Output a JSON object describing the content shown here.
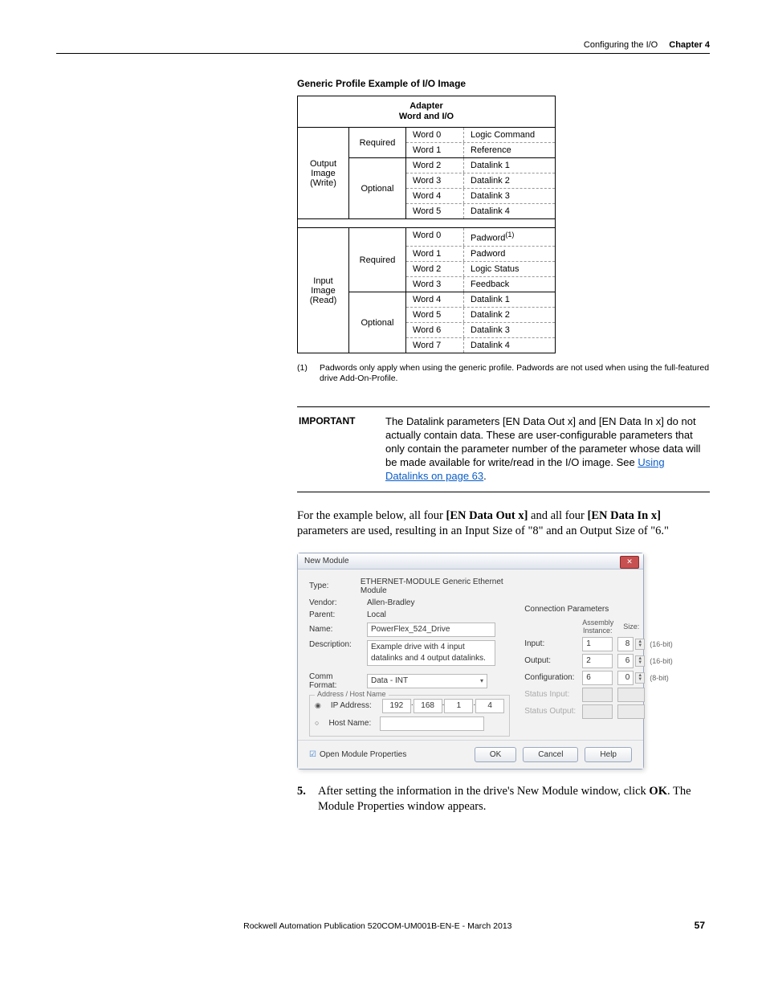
{
  "header": {
    "breadcrumb": "Configuring the I/O",
    "chapter": "Chapter 4"
  },
  "section_title": "Generic Profile Example of I/O Image",
  "adapter": {
    "title1": "Adapter",
    "title2": "Word and I/O",
    "groups": [
      {
        "label": "Output Image (Write)",
        "sub": [
          {
            "type": "Required",
            "rows": [
              {
                "word": "Word 0",
                "val": "Logic Command"
              },
              {
                "word": "Word 1",
                "val": "Reference"
              }
            ]
          },
          {
            "type": "Optional",
            "rows": [
              {
                "word": "Word 2",
                "val": "Datalink 1"
              },
              {
                "word": "Word 3",
                "val": "Datalink 2"
              },
              {
                "word": "Word 4",
                "val": "Datalink 3"
              },
              {
                "word": "Word 5",
                "val": "Datalink 4"
              }
            ]
          }
        ]
      },
      {
        "label": "Input Image (Read)",
        "sub": [
          {
            "type": "Required",
            "rows": [
              {
                "word": "Word 0",
                "val_raw": "Padword",
                "sup": "(1)"
              },
              {
                "word": "Word 1",
                "val": "Padword"
              },
              {
                "word": "Word 2",
                "val": "Logic Status"
              },
              {
                "word": "Word 3",
                "val": "Feedback"
              }
            ]
          },
          {
            "type": "Optional",
            "rows": [
              {
                "word": "Word 4",
                "val": "Datalink 1"
              },
              {
                "word": "Word 5",
                "val": "Datalink 2"
              },
              {
                "word": "Word 6",
                "val": "Datalink 3"
              },
              {
                "word": "Word 7",
                "val": "Datalink 4"
              }
            ]
          }
        ]
      }
    ]
  },
  "footnote": {
    "num": "(1)",
    "text": "Padwords only apply when using the generic profile. Padwords are not used when using the full-featured drive Add-On-Profile."
  },
  "important": {
    "label": "IMPORTANT",
    "text_pre": "The Datalink parameters [EN Data Out x] and [EN Data In x] do not actually contain data. These are user-configurable parameters that only contain the parameter number of the parameter whose data will be made available for write/read in the I/O image. See ",
    "link": "Using Datalinks on page 63",
    "text_post": "."
  },
  "body_para": "For the example below, all four [EN Data Out x] and all four [EN Data In x] parameters are used, resulting in an Input Size of \"8\" and an Output Size of \"6.\"",
  "dialog": {
    "title": "New Module",
    "type_lbl": "Type:",
    "type_val": "ETHERNET-MODULE Generic Ethernet Module",
    "vendor_lbl": "Vendor:",
    "vendor_val": "Allen-Bradley",
    "parent_lbl": "Parent:",
    "parent_val": "Local",
    "name_lbl": "Name:",
    "name_val": "PowerFlex_524_Drive",
    "desc_lbl": "Description:",
    "desc_val": "Example drive with 4 input datalinks and 4 output datalinks.",
    "comm_lbl": "Comm Format:",
    "comm_val": "Data - INT",
    "addr_group": "Address / Host Name",
    "ip_lbl": "IP Address:",
    "ip": [
      "192",
      "168",
      "1",
      "4"
    ],
    "host_lbl": "Host Name:",
    "open_props": "Open Module Properties",
    "conn_title": "Connection Parameters",
    "col_assembly": "Assembly Instance:",
    "col_size": "Size:",
    "rows": {
      "input": {
        "lbl": "Input:",
        "inst": "1",
        "size": "8",
        "unit": "(16-bit)"
      },
      "output": {
        "lbl": "Output:",
        "inst": "2",
        "size": "6",
        "unit": "(16-bit)"
      },
      "config": {
        "lbl": "Configuration:",
        "inst": "6",
        "size": "0",
        "unit": "(8-bit)"
      },
      "sin": {
        "lbl": "Status Input:"
      },
      "sout": {
        "lbl": "Status Output:"
      }
    },
    "ok": "OK",
    "cancel": "Cancel",
    "help": "Help"
  },
  "step5": {
    "num": "5.",
    "text_a": "After setting the information in the drive's New Module window, click ",
    "bold": "OK",
    "text_b": ". The Module Properties window appears."
  },
  "footer": {
    "pub": "Rockwell Automation Publication 520COM-UM001B-EN-E - March 2013",
    "page": "57"
  }
}
